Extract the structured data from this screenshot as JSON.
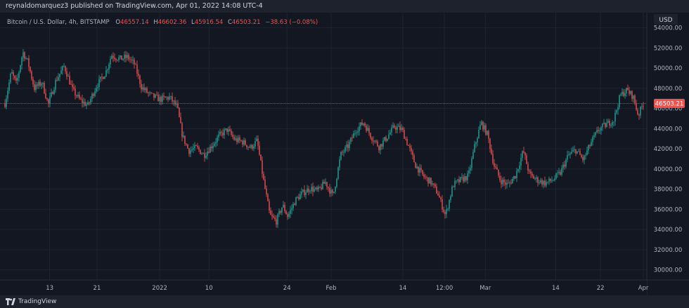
{
  "header": {
    "publisher_text": "reynaldomarquez3 published on TradingView.com, Apr 01, 2022 14:08 UTC-4"
  },
  "legend": {
    "symbol": "Bitcoin / U.S. Dollar, 4h, BITSTAMP",
    "open_label": "O",
    "open": "46557.14",
    "high_label": "H",
    "high": "46602.36",
    "low_label": "L",
    "low": "45916.54",
    "close_label": "C",
    "close": "46503.21",
    "change": "−38.63 (−0.08%)"
  },
  "footer": {
    "brand": "TradingView"
  },
  "colors": {
    "up": "#26a69a",
    "down": "#ef5350",
    "grid": "#1f2330",
    "axis_text": "#b2b5be",
    "price_line": "#ef5350",
    "last_price_bg": "#ef5350"
  },
  "chart_data": {
    "type": "candlestick",
    "currency_label": "USD",
    "last_price": 46503.21,
    "last_price_label": "46503.21",
    "y_range": [
      29000,
      55500
    ],
    "y_ticks": [
      30000,
      32000,
      34000,
      36000,
      38000,
      40000,
      42000,
      44000,
      46000,
      48000,
      50000,
      52000,
      54000
    ],
    "y_tick_labels": [
      "30000.00",
      "32000.00",
      "34000.00",
      "36000.00",
      "38000.00",
      "40000.00",
      "42000.00",
      "44000.00",
      "46000.00",
      "48000.00",
      "50000.00",
      "52000.00",
      "54000.00"
    ],
    "x_ticks": [
      {
        "label": "13",
        "t": 0.071
      },
      {
        "label": "21",
        "t": 0.145
      },
      {
        "label": "2022",
        "t": 0.243
      },
      {
        "label": "10",
        "t": 0.32
      },
      {
        "label": "24",
        "t": 0.442
      },
      {
        "label": "Feb",
        "t": 0.511
      },
      {
        "label": "14",
        "t": 0.623
      },
      {
        "label": "12:00",
        "t": 0.688
      },
      {
        "label": "Mar",
        "t": 0.752
      },
      {
        "label": "14",
        "t": 0.862
      },
      {
        "label": "22",
        "t": 0.932
      },
      {
        "label": "Apr",
        "t": 0.999
      }
    ],
    "series_approx": [
      {
        "t": 0.0,
        "p": 46500
      },
      {
        "t": 0.01,
        "p": 49600
      },
      {
        "t": 0.018,
        "p": 48400
      },
      {
        "t": 0.028,
        "p": 51600
      },
      {
        "t": 0.036,
        "p": 50600
      },
      {
        "t": 0.046,
        "p": 48000
      },
      {
        "t": 0.058,
        "p": 48600
      },
      {
        "t": 0.068,
        "p": 46400
      },
      {
        "t": 0.08,
        "p": 48800
      },
      {
        "t": 0.093,
        "p": 50200
      },
      {
        "t": 0.106,
        "p": 47800
      },
      {
        "t": 0.118,
        "p": 46800
      },
      {
        "t": 0.13,
        "p": 46300
      },
      {
        "t": 0.143,
        "p": 48200
      },
      {
        "t": 0.158,
        "p": 49600
      },
      {
        "t": 0.167,
        "p": 51300
      },
      {
        "t": 0.18,
        "p": 50900
      },
      {
        "t": 0.192,
        "p": 51100
      },
      {
        "t": 0.203,
        "p": 50400
      },
      {
        "t": 0.214,
        "p": 48100
      },
      {
        "t": 0.228,
        "p": 47300
      },
      {
        "t": 0.243,
        "p": 46900
      },
      {
        "t": 0.258,
        "p": 47100
      },
      {
        "t": 0.27,
        "p": 46100
      },
      {
        "t": 0.278,
        "p": 43300
      },
      {
        "t": 0.288,
        "p": 41800
      },
      {
        "t": 0.3,
        "p": 42100
      },
      {
        "t": 0.312,
        "p": 41400
      },
      {
        "t": 0.324,
        "p": 42300
      },
      {
        "t": 0.336,
        "p": 43300
      },
      {
        "t": 0.348,
        "p": 43900
      },
      {
        "t": 0.36,
        "p": 42900
      },
      {
        "t": 0.372,
        "p": 42700
      },
      {
        "t": 0.385,
        "p": 42100
      },
      {
        "t": 0.395,
        "p": 42800
      },
      {
        "t": 0.405,
        "p": 38900
      },
      {
        "t": 0.415,
        "p": 35400
      },
      {
        "t": 0.425,
        "p": 34800
      },
      {
        "t": 0.435,
        "p": 36400
      },
      {
        "t": 0.443,
        "p": 35300
      },
      {
        "t": 0.455,
        "p": 36900
      },
      {
        "t": 0.466,
        "p": 37600
      },
      {
        "t": 0.478,
        "p": 38100
      },
      {
        "t": 0.49,
        "p": 37800
      },
      {
        "t": 0.502,
        "p": 38700
      },
      {
        "t": 0.514,
        "p": 37300
      },
      {
        "t": 0.526,
        "p": 41400
      },
      {
        "t": 0.538,
        "p": 42300
      },
      {
        "t": 0.55,
        "p": 43900
      },
      {
        "t": 0.562,
        "p": 44600
      },
      {
        "t": 0.574,
        "p": 43200
      },
      {
        "t": 0.586,
        "p": 42200
      },
      {
        "t": 0.598,
        "p": 43100
      },
      {
        "t": 0.61,
        "p": 44200
      },
      {
        "t": 0.622,
        "p": 43900
      },
      {
        "t": 0.632,
        "p": 42300
      },
      {
        "t": 0.643,
        "p": 40400
      },
      {
        "t": 0.655,
        "p": 39300
      },
      {
        "t": 0.667,
        "p": 38700
      },
      {
        "t": 0.678,
        "p": 37600
      },
      {
        "t": 0.69,
        "p": 35400
      },
      {
        "t": 0.702,
        "p": 38400
      },
      {
        "t": 0.714,
        "p": 38900
      },
      {
        "t": 0.726,
        "p": 39300
      },
      {
        "t": 0.736,
        "p": 42300
      },
      {
        "t": 0.746,
        "p": 44600
      },
      {
        "t": 0.756,
        "p": 43400
      },
      {
        "t": 0.766,
        "p": 40400
      },
      {
        "t": 0.776,
        "p": 38900
      },
      {
        "t": 0.788,
        "p": 38400
      },
      {
        "t": 0.8,
        "p": 39400
      },
      {
        "t": 0.812,
        "p": 41800
      },
      {
        "t": 0.822,
        "p": 39400
      },
      {
        "t": 0.834,
        "p": 38900
      },
      {
        "t": 0.846,
        "p": 38600
      },
      {
        "t": 0.858,
        "p": 38900
      },
      {
        "t": 0.87,
        "p": 39600
      },
      {
        "t": 0.882,
        "p": 41300
      },
      {
        "t": 0.894,
        "p": 41900
      },
      {
        "t": 0.906,
        "p": 40900
      },
      {
        "t": 0.918,
        "p": 42600
      },
      {
        "t": 0.93,
        "p": 43900
      },
      {
        "t": 0.942,
        "p": 44400
      },
      {
        "t": 0.954,
        "p": 44900
      },
      {
        "t": 0.964,
        "p": 47300
      },
      {
        "t": 0.974,
        "p": 47800
      },
      {
        "t": 0.984,
        "p": 47200
      },
      {
        "t": 0.992,
        "p": 45300
      },
      {
        "t": 1.0,
        "p": 46500
      }
    ]
  }
}
